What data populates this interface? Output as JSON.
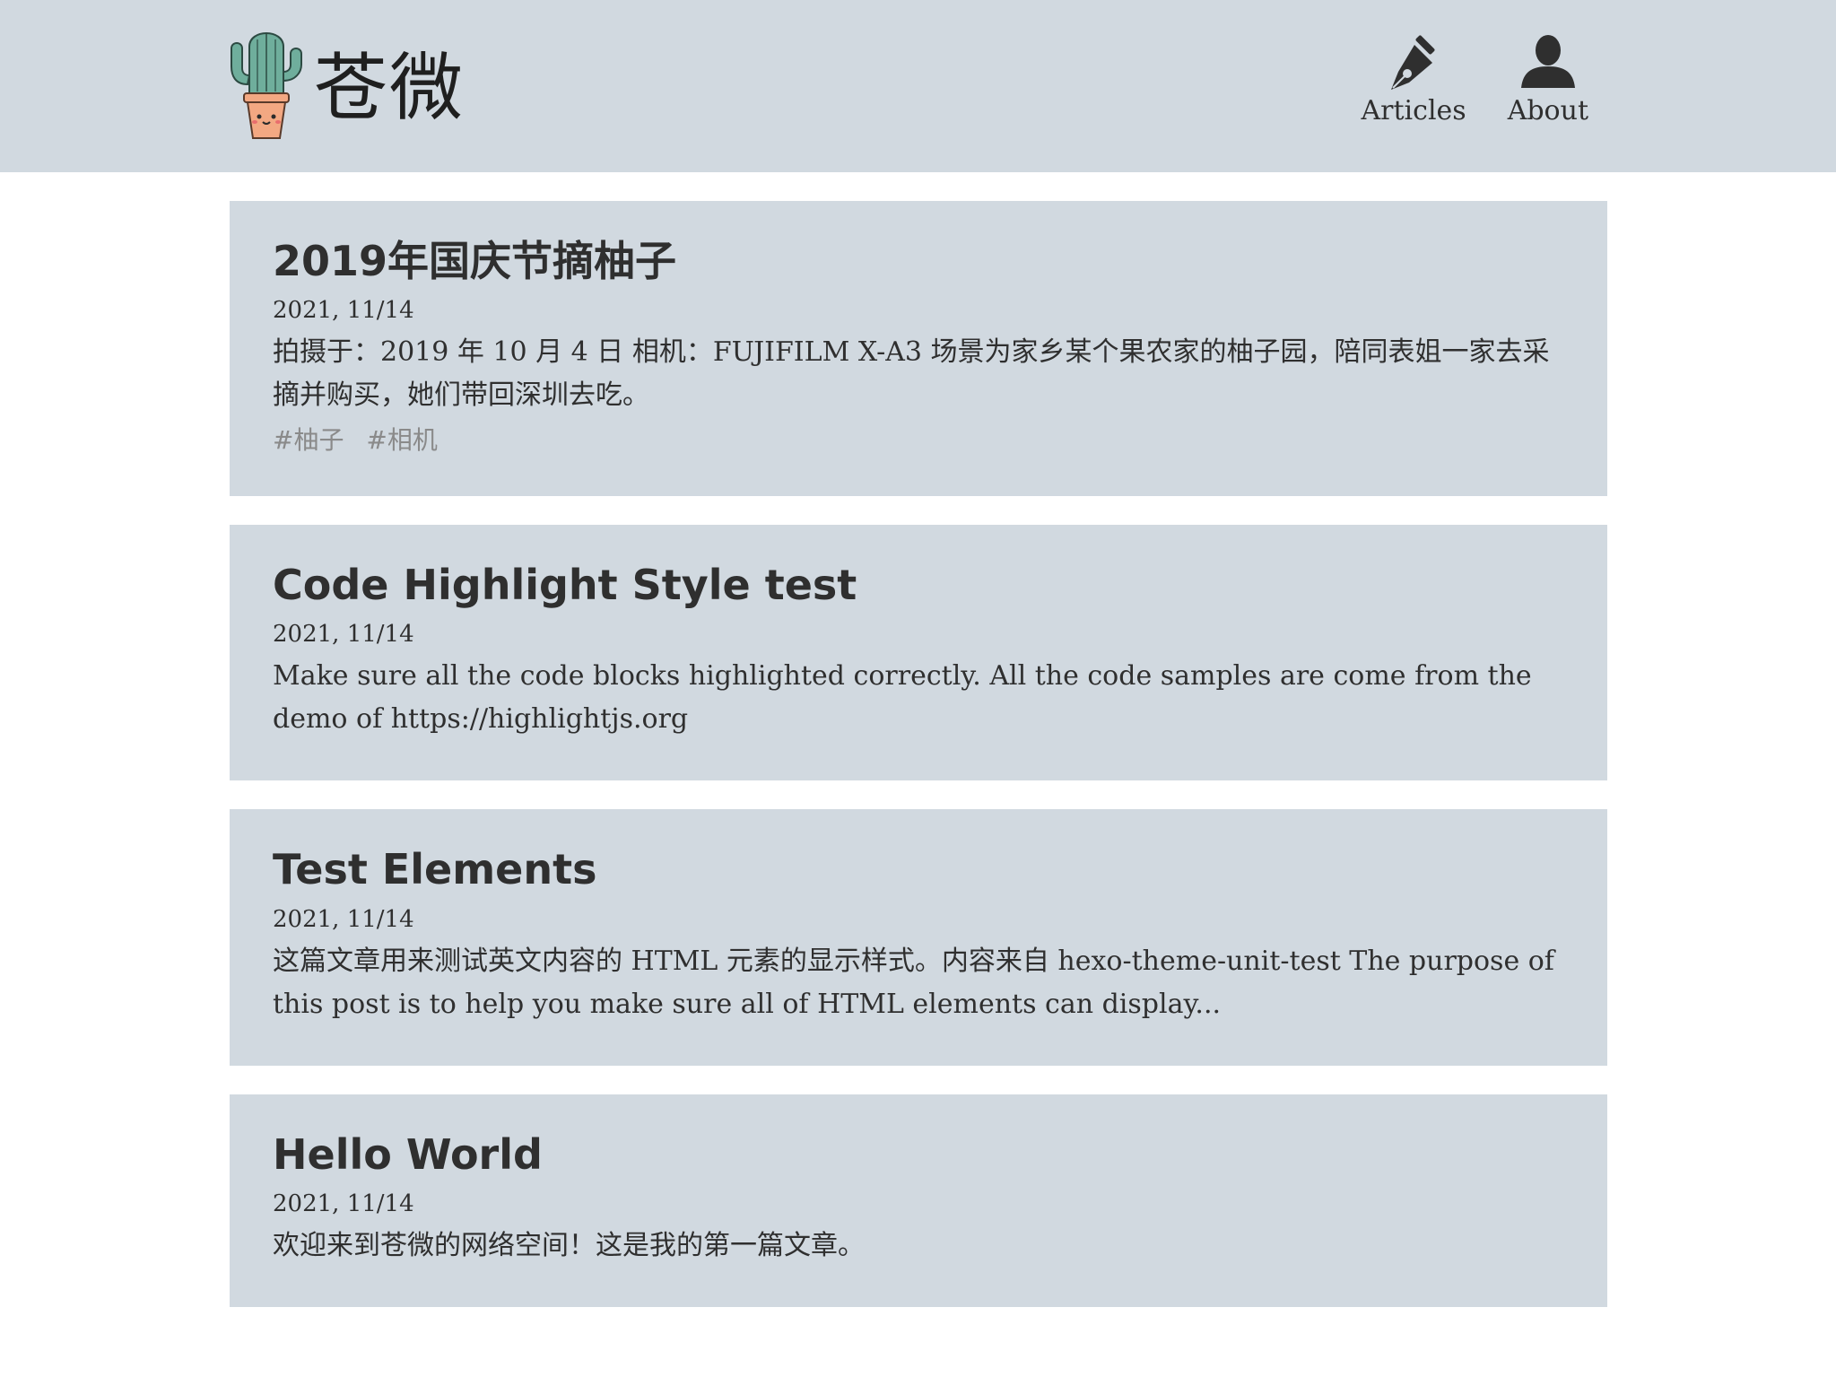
{
  "site": {
    "name": "苍微",
    "logo_icon": "cactus-logo-icon"
  },
  "nav": [
    {
      "label": "Articles",
      "icon": "fountain-pen-icon"
    },
    {
      "label": "About",
      "icon": "user-icon"
    }
  ],
  "posts": [
    {
      "title": "2019年国庆节摘柚子",
      "date": "2021, 11/14",
      "summary": "拍摄于：2019 年 10 月 4 日 相机：FUJIFILM X-A3 场景为家乡某个果农家的柚子园，陪同表姐一家去采摘并购买，她们带回深圳去吃。",
      "tags": [
        "#柚子",
        "#相机"
      ]
    },
    {
      "title": "Code Highlight Style test",
      "date": "2021, 11/14",
      "summary": "Make sure all the code blocks highlighted correctly. All the code samples are come from the demo of https://highlightjs.org"
    },
    {
      "title": "Test Elements",
      "date": "2021, 11/14",
      "summary": "这篇文章用来测试英文内容的 HTML 元素的显示样式。内容来自 hexo-theme-unit-test The purpose of this post is to help you make sure all of HTML elements can display..."
    },
    {
      "title": "Hello World",
      "date": "2021, 11/14",
      "summary": "欢迎来到苍微的网络空间！这是我的第一篇文章。"
    }
  ],
  "colors": {
    "panel": "#d1d9e0",
    "text": "#2f2f2f",
    "tag": "#8a8a8a"
  }
}
